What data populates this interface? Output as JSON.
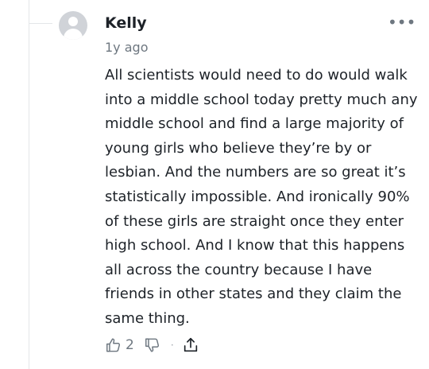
{
  "comment": {
    "author": "Kelly",
    "timestamp": "1y ago",
    "text": "All scientists would need to do would walk into a middle school today pretty much any middle school and find a large majority of young girls who believe they’re by or lesbian. And the numbers are so great it’s statistically impossible. And ironically 90% of these girls are straight once they enter high school. And I know that this happens all across the country because I have friends in other states and they claim the same thing.",
    "more_icon": "more-horizontal-icon",
    "more_glyph": "•••",
    "avatar_icon": "default-user-avatar"
  },
  "actions": {
    "thumbs_up_icon": "thumbs-up-icon",
    "thumbs_up_count": "2",
    "thumbs_down_icon": "thumbs-down-icon",
    "separator": "·",
    "share_icon": "share-icon"
  },
  "colors": {
    "text": "#1d2228",
    "muted": "#6e7780",
    "avatar_bg": "#d0d3d8",
    "thread_line": "#e4e6e9"
  }
}
